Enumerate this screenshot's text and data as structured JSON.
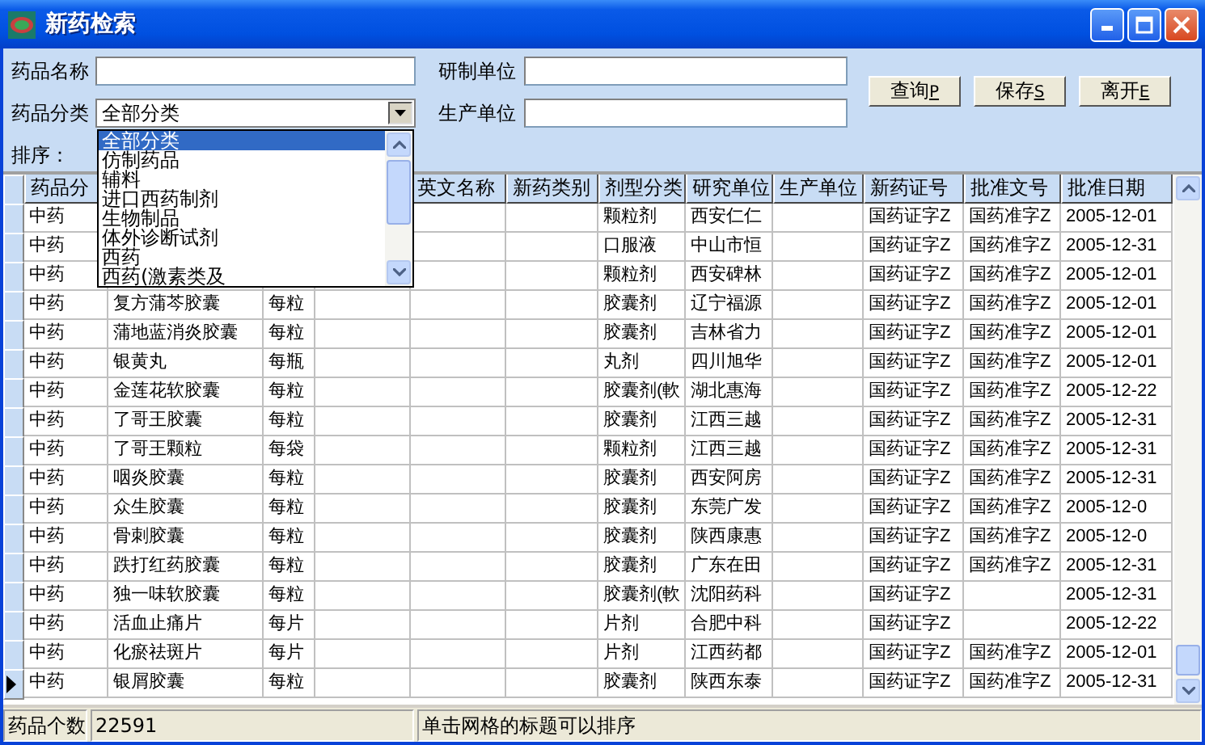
{
  "window": {
    "title": "新药检索"
  },
  "form": {
    "fields": [
      {
        "label": "药品名称",
        "kind": "text"
      },
      {
        "label": "研制单位",
        "kind": "text"
      },
      {
        "label": "药品分类",
        "kind": "combo",
        "value": "全部分类",
        "expanded": true,
        "options": [
          {
            "label": "全部分类",
            "selected": true
          },
          {
            "label": "仿制药品",
            "selected": false
          },
          {
            "label": "辅料",
            "selected": false
          },
          {
            "label": "进口西药制剂",
            "selected": false
          },
          {
            "label": "生物制品",
            "selected": false
          },
          {
            "label": "体外诊断试剂",
            "selected": false
          },
          {
            "label": "西药",
            "selected": false
          },
          {
            "label": "西药(激素类及",
            "selected": false
          }
        ]
      },
      {
        "label": "生产单位",
        "kind": "text"
      }
    ],
    "sort_label": "排序：",
    "buttons": [
      {
        "label": "查询",
        "accelerator": "P"
      },
      {
        "label": "保存",
        "accelerator": "S"
      },
      {
        "label": "离开",
        "accelerator": "E"
      }
    ]
  },
  "table": {
    "columns": [
      "药品分",
      null,
      null,
      null,
      "英文名称",
      "新药类别",
      "剂型分类",
      "研究单位",
      "生产单位",
      "新药证号",
      "批准文号",
      "批准日期"
    ],
    "rows": [
      {
        "current": false,
        "cells": [
          "中药",
          null,
          null,
          null,
          null,
          null,
          "颗粒剂",
          "西安仁仁",
          null,
          "国药证字Z",
          "国药准字Z",
          "2005-12-01"
        ]
      },
      {
        "current": false,
        "cells": [
          "中药",
          null,
          null,
          null,
          null,
          null,
          "口服液",
          "中山市恒",
          null,
          "国药证字Z",
          "国药准字Z",
          "2005-12-31"
        ]
      },
      {
        "current": false,
        "cells": [
          "中药",
          null,
          null,
          null,
          null,
          null,
          "颗粒剂",
          "西安碑林",
          null,
          "国药证字Z",
          "国药准字Z",
          "2005-12-01"
        ]
      },
      {
        "current": false,
        "cells": [
          "中药",
          "复方蒲芩胶囊",
          "每粒",
          null,
          null,
          null,
          "胶囊剂",
          "辽宁福源",
          null,
          "国药证字Z",
          "国药准字Z",
          "2005-12-01"
        ]
      },
      {
        "current": false,
        "cells": [
          "中药",
          "蒲地蓝消炎胶囊",
          "每粒",
          null,
          null,
          null,
          "胶囊剂",
          "吉林省力",
          null,
          "国药证字Z",
          "国药准字Z",
          "2005-12-01"
        ]
      },
      {
        "current": false,
        "cells": [
          "中药",
          "银黄丸",
          "每瓶",
          null,
          null,
          null,
          "丸剂",
          "四川旭华",
          null,
          "国药证字Z",
          "国药准字Z",
          "2005-12-01"
        ]
      },
      {
        "current": false,
        "cells": [
          "中药",
          "金莲花软胶囊",
          "每粒",
          null,
          null,
          null,
          "胶囊剂(軟",
          "湖北惠海",
          null,
          "国药证字Z",
          "国药准字Z",
          "2005-12-22"
        ]
      },
      {
        "current": false,
        "cells": [
          "中药",
          "了哥王胶囊",
          "每粒",
          null,
          null,
          null,
          "胶囊剂",
          "江西三越",
          null,
          "国药证字Z",
          "国药准字Z",
          "2005-12-31"
        ]
      },
      {
        "current": false,
        "cells": [
          "中药",
          "了哥王颗粒",
          "每袋",
          null,
          null,
          null,
          "颗粒剂",
          "江西三越",
          null,
          "国药证字Z",
          "国药准字Z",
          "2005-12-31"
        ]
      },
      {
        "current": false,
        "cells": [
          "中药",
          "咽炎胶囊",
          "每粒",
          null,
          null,
          null,
          "胶囊剂",
          "西安阿房",
          null,
          "国药证字Z",
          "国药准字Z",
          "2005-12-31"
        ]
      },
      {
        "current": false,
        "cells": [
          "中药",
          "众生胶囊",
          "每粒",
          null,
          null,
          null,
          "胶囊剂",
          "东莞广发",
          null,
          "国药证字Z",
          "国药准字Z",
          "2005-12-0"
        ]
      },
      {
        "current": false,
        "cells": [
          "中药",
          "骨刺胶囊",
          "每粒",
          null,
          null,
          null,
          "胶囊剂",
          "陕西康惠",
          null,
          "国药证字Z",
          "国药准字Z",
          "2005-12-0"
        ]
      },
      {
        "current": false,
        "cells": [
          "中药",
          "跌打红药胶囊",
          "每粒",
          null,
          null,
          null,
          "胶囊剂",
          "广东在田",
          null,
          "国药证字Z",
          "国药准字Z",
          "2005-12-31"
        ]
      },
      {
        "current": false,
        "cells": [
          "中药",
          "独一味软胶囊",
          "每粒",
          null,
          null,
          null,
          "胶囊剂(軟",
          "沈阳药科",
          null,
          "国药证字Z",
          null,
          "2005-12-31"
        ]
      },
      {
        "current": false,
        "cells": [
          "中药",
          "活血止痛片",
          "每片",
          null,
          null,
          null,
          "片剂",
          "合肥中科",
          null,
          "国药证字Z",
          null,
          "2005-12-22"
        ]
      },
      {
        "current": false,
        "cells": [
          "中药",
          "化瘀祛斑片",
          "每片",
          null,
          null,
          null,
          "片剂",
          "江西药都",
          null,
          "国药证字Z",
          "国药准字Z",
          "2005-12-01"
        ]
      },
      {
        "current": true,
        "cells": [
          "中药",
          "银屑胶囊",
          "每粒",
          null,
          null,
          null,
          "胶囊剂",
          "陕西东泰",
          null,
          "国药证字Z",
          "国药准字Z",
          "2005-12-31"
        ]
      }
    ]
  },
  "status_bar": {
    "count_label": "药品个数",
    "count": "22591",
    "hint": "单击网格的标题可以排序"
  }
}
